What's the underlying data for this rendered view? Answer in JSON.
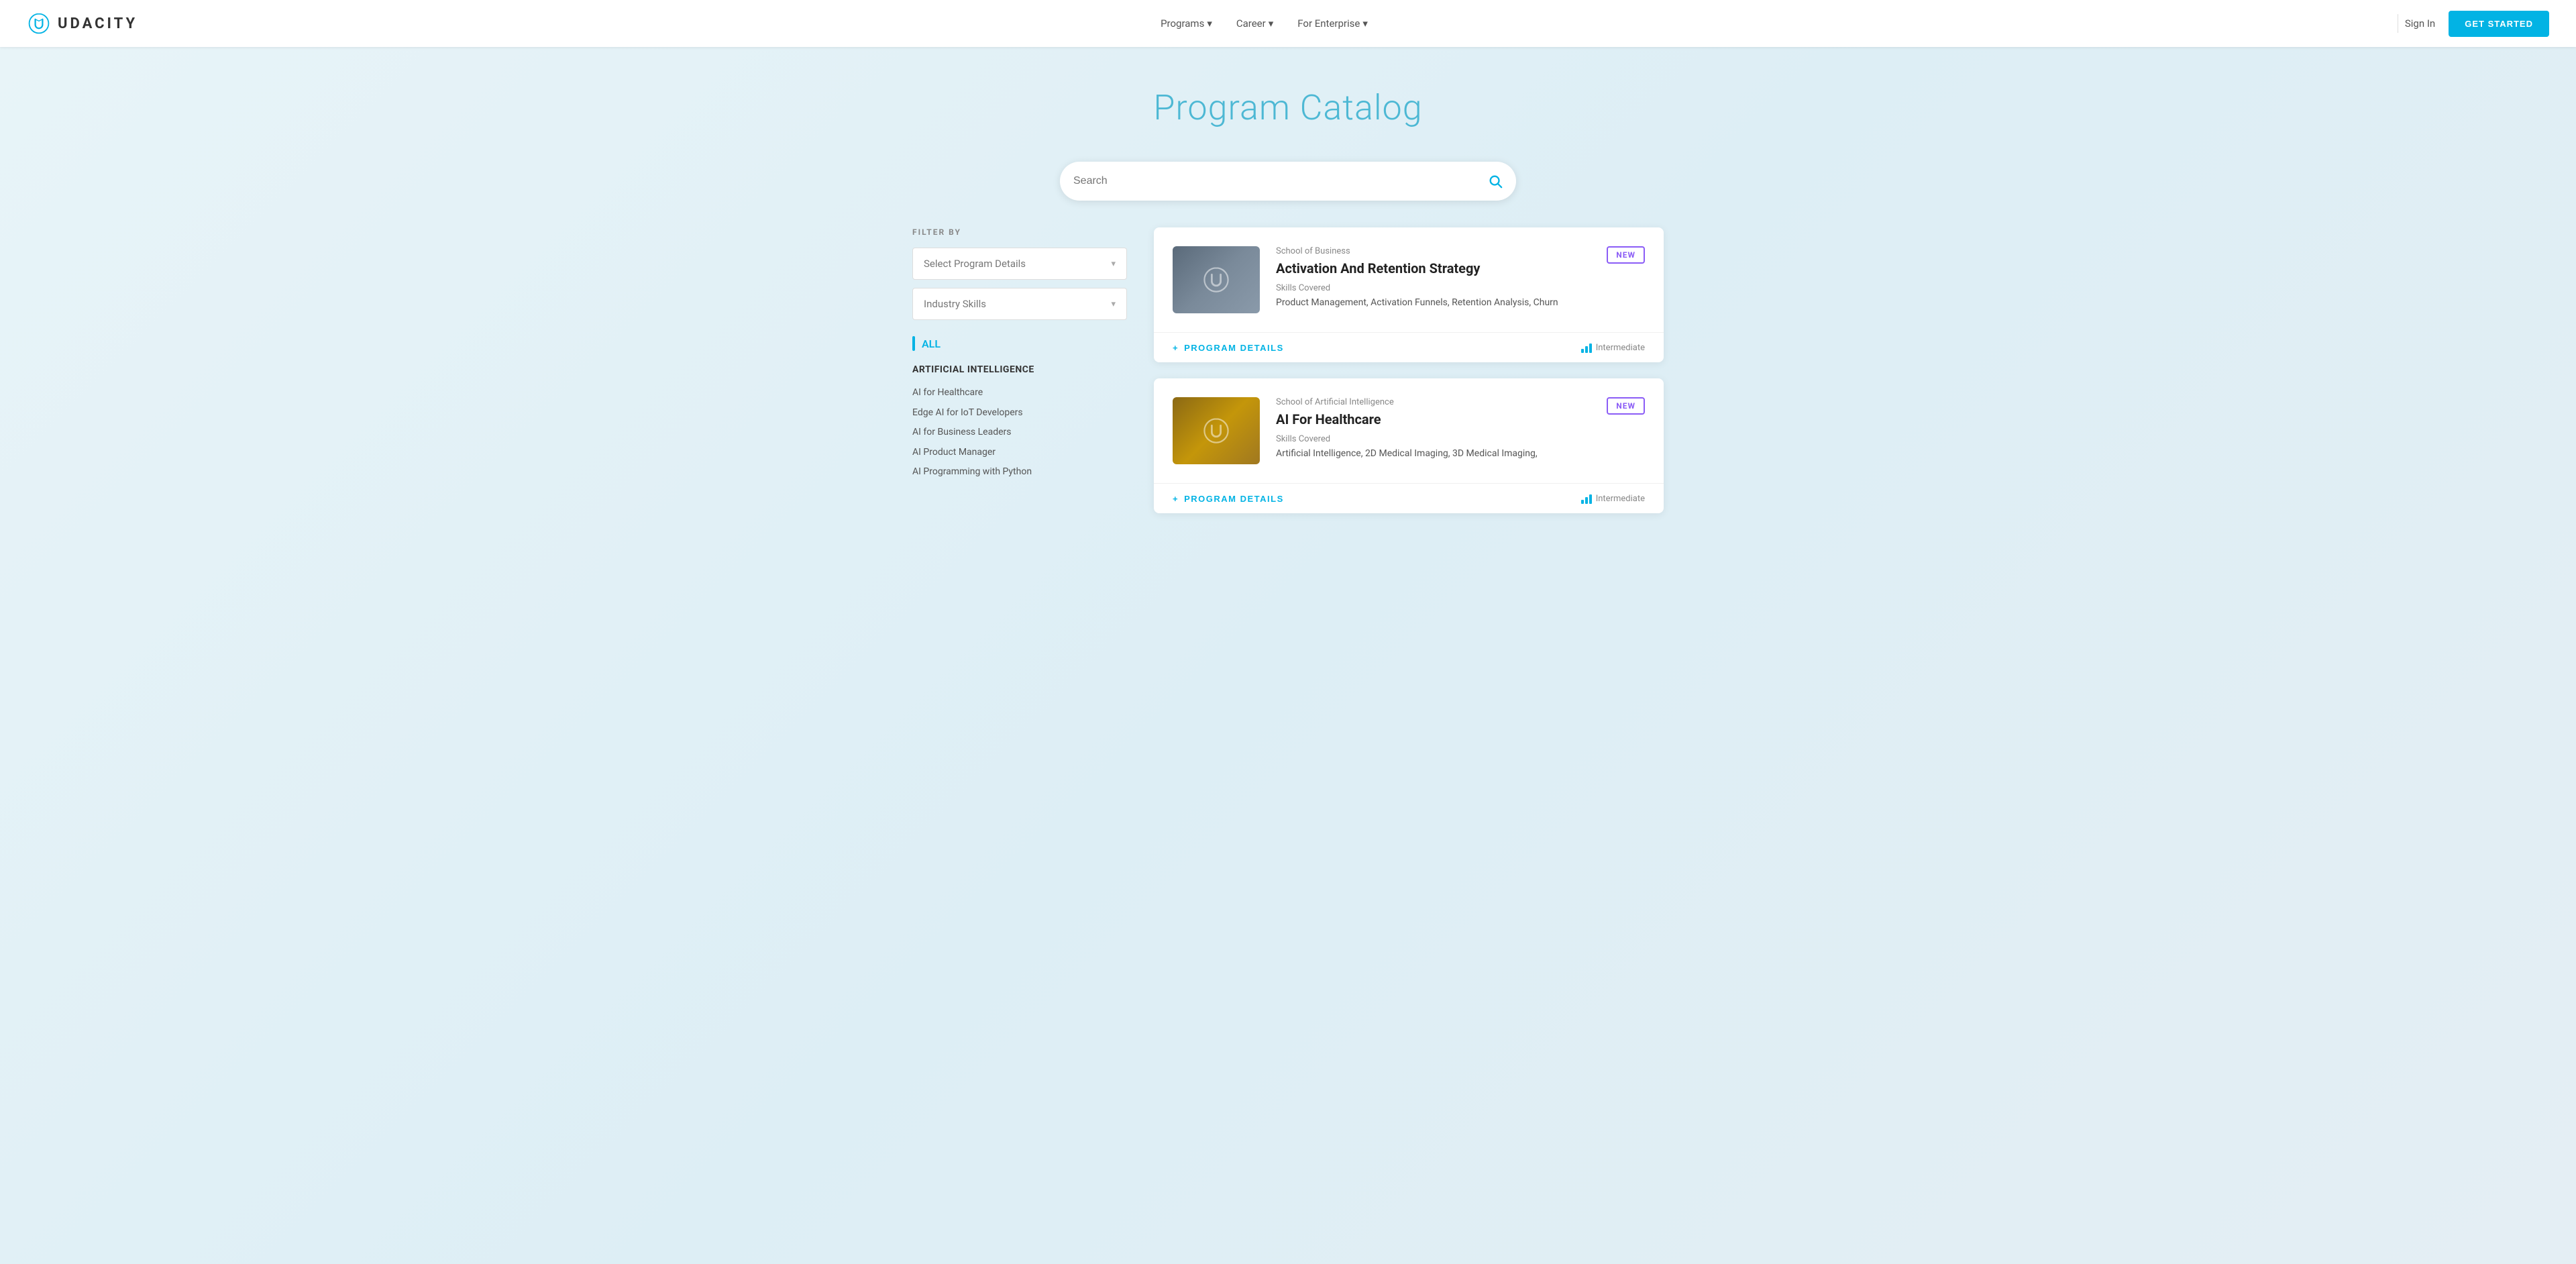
{
  "navbar": {
    "logo_text": "UDACITY",
    "nav_links": [
      {
        "label": "Programs",
        "has_dropdown": true
      },
      {
        "label": "Career",
        "has_dropdown": true
      },
      {
        "label": "For Enterprise",
        "has_dropdown": true
      }
    ],
    "sign_in_label": "Sign In",
    "get_started_label": "GET STARTED"
  },
  "hero": {
    "title": "Program Catalog"
  },
  "search": {
    "placeholder": "Search"
  },
  "sidebar": {
    "filter_label": "FILTER BY",
    "select_program_details_label": "Select Program Details",
    "industry_skills_label": "Industry Skills",
    "all_label": "ALL",
    "category_title": "ARTIFICIAL INTELLIGENCE",
    "category_items": [
      "AI for Healthcare",
      "Edge AI for IoT Developers",
      "AI for Business Leaders",
      "AI Product Manager",
      "AI Programming with Python"
    ]
  },
  "cards": [
    {
      "school": "School of Business",
      "title": "Activation And Retention Strategy",
      "badge": "NEW",
      "skills_label": "Skills Covered",
      "skills": "Product Management, Activation Funnels, Retention Analysis, Churn",
      "program_details_label": "PROGRAM DETAILS",
      "difficulty": "Intermediate",
      "thumbnail_type": "business"
    },
    {
      "school": "School of Artificial Intelligence",
      "title": "AI For Healthcare",
      "badge": "NEW",
      "skills_label": "Skills Covered",
      "skills": "Artificial Intelligence, 2D Medical Imaging, 3D Medical Imaging,",
      "program_details_label": "PROGRAM DETAILS",
      "difficulty": "Intermediate",
      "thumbnail_type": "ai"
    }
  ],
  "icons": {
    "search": "🔍",
    "chevron_down": "▾",
    "plus": "+",
    "bar_chart": "📊"
  }
}
